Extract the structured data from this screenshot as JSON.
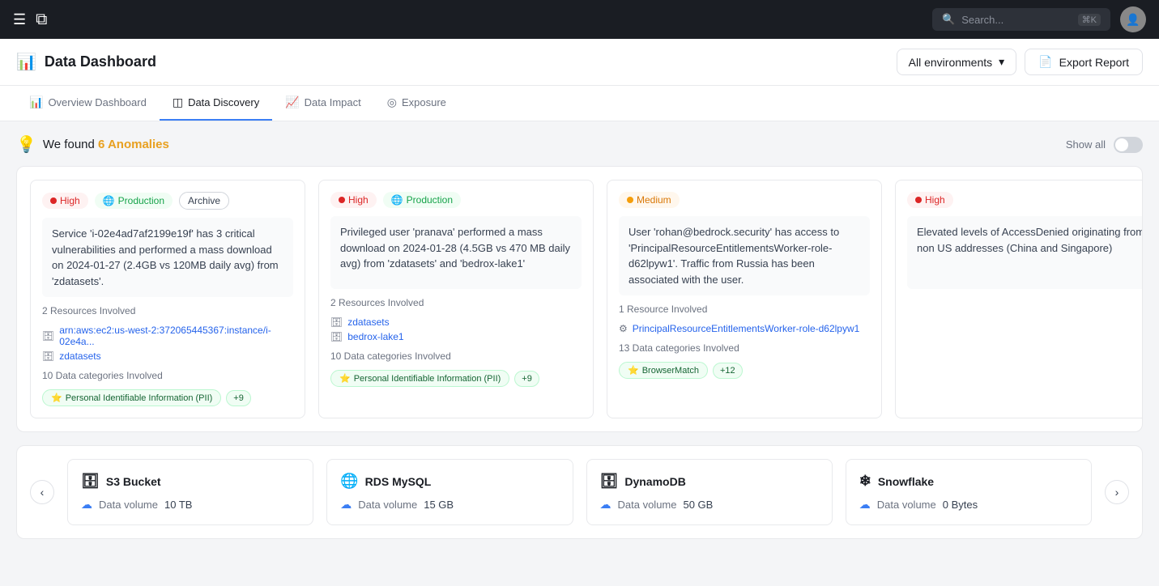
{
  "nav": {
    "search_placeholder": "Search...",
    "search_kbd": "⌘K",
    "logo_symbol": "⧉"
  },
  "header": {
    "title": "Data Dashboard",
    "env_label": "All environments",
    "export_label": "Export Report"
  },
  "tabs": [
    {
      "id": "overview",
      "label": "Overview Dashboard",
      "icon": "📊",
      "active": false
    },
    {
      "id": "data-discovery",
      "label": "Data Discovery",
      "icon": "◫",
      "active": true
    },
    {
      "id": "data-impact",
      "label": "Data Impact",
      "icon": "📈",
      "active": false
    },
    {
      "id": "exposure",
      "label": "Exposure",
      "icon": "◎",
      "active": false
    }
  ],
  "anomalies": {
    "icon": "💡",
    "prefix": "We found ",
    "count": "6 Anomalies",
    "show_all_label": "Show all"
  },
  "cards": [
    {
      "severity": "High",
      "severity_type": "high",
      "env": "Production",
      "env_type": "production",
      "archive_label": "Archive",
      "description": "Service 'i-02e4ad7af2199e19f' has 3 critical vulnerabilities and performed a mass download on 2024-01-27 (2.4GB vs 120MB daily avg) from 'zdatasets'.",
      "resources_count": "2 Resources Involved",
      "resources": [
        {
          "name": "arn:aws:ec2:us-west-2:372065445367:instance/i-02e4a...",
          "icon": "🗄"
        },
        {
          "name": "zdatasets",
          "icon": "🗄"
        }
      ],
      "categories_count": "10 Data categories Involved",
      "categories": [
        {
          "label": "Personal Identifiable Information (PII)"
        }
      ],
      "extra_count": "+9"
    },
    {
      "severity": "High",
      "severity_type": "high",
      "env": "Production",
      "env_type": "production",
      "archive_label": null,
      "description": "Privileged user 'pranava' performed a mass download on 2024-01-28 (4.5GB vs 470 MB daily avg) from 'zdatasets' and 'bedrox-lake1'",
      "resources_count": "2 Resources Involved",
      "resources": [
        {
          "name": "zdatasets",
          "icon": "🗄"
        },
        {
          "name": "bedrox-lake1",
          "icon": "🗄"
        }
      ],
      "categories_count": "10 Data categories Involved",
      "categories": [
        {
          "label": "Personal Identifiable Information (PII)"
        }
      ],
      "extra_count": "+9"
    },
    {
      "severity": "Medium",
      "severity_type": "medium",
      "env": null,
      "env_type": null,
      "archive_label": null,
      "description": "User 'rohan@bedrock.security' has access to 'PrincipalResourceEntitlementsWorker-role-d62lpyw1'. Traffic from Russia has been associated with the user.",
      "resources_count": "1 Resource Involved",
      "resources": [
        {
          "name": "PrincipalResourceEntitlementsWorker-role-d62lpyw1",
          "icon": "⚙"
        }
      ],
      "categories_count": "13 Data categories Involved",
      "categories": [
        {
          "label": "BrowserMatch"
        }
      ],
      "extra_count": "+12"
    },
    {
      "severity": "High",
      "severity_type": "high",
      "env": null,
      "env_type": null,
      "archive_label": null,
      "description": "Elevated levels of AccessDenied originating from non US addresses (China and Singapore)",
      "resources_count": null,
      "resources": [],
      "categories_count": null,
      "categories": [],
      "extra_count": null
    }
  ],
  "data_sources": [
    {
      "name": "S3 Bucket",
      "icon": "🗄",
      "volume_label": "Data volume",
      "volume": "10 TB"
    },
    {
      "name": "RDS MySQL",
      "icon": "🌐",
      "volume_label": "Data volume",
      "volume": "15 GB"
    },
    {
      "name": "DynamoDB",
      "icon": "🗄",
      "volume_label": "Data volume",
      "volume": "50 GB"
    },
    {
      "name": "Snowflake",
      "icon": "❄",
      "volume_label": "Data volume",
      "volume": "0 Bytes"
    }
  ]
}
